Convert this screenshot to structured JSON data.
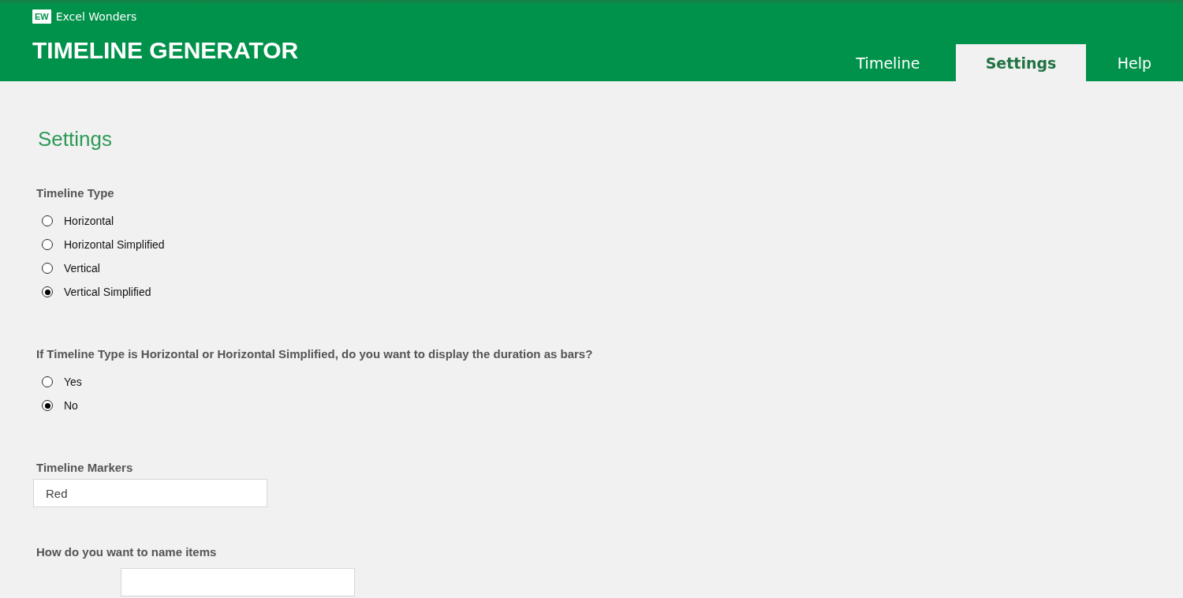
{
  "brand": {
    "name": "Excel Wonders",
    "logo_text": "EW"
  },
  "app_title": "TIMELINE GENERATOR",
  "tabs": [
    {
      "label": "Timeline",
      "selected": false
    },
    {
      "label": "Settings",
      "selected": true
    },
    {
      "label": "Help",
      "selected": false
    }
  ],
  "page_heading": "Settings",
  "sections": [
    {
      "kind": "radio_group",
      "label": "Timeline Type",
      "options": [
        {
          "label": "Horizontal",
          "selected": false
        },
        {
          "label": "Horizontal Simplified",
          "selected": false
        },
        {
          "label": "Vertical",
          "selected": false
        },
        {
          "label": "Vertical Simplified",
          "selected": true
        }
      ]
    },
    {
      "kind": "radio_group",
      "label": "If Timeline Type is Horizontal or Horizontal Simplified, do you want to display the duration as bars?",
      "options": [
        {
          "label": "Yes",
          "selected": false
        },
        {
          "label": "No",
          "selected": true
        }
      ]
    },
    {
      "kind": "text_field",
      "label": "Timeline Markers",
      "value": "Red"
    },
    {
      "kind": "text_field",
      "label": "How do you want to name items"
    }
  ]
}
